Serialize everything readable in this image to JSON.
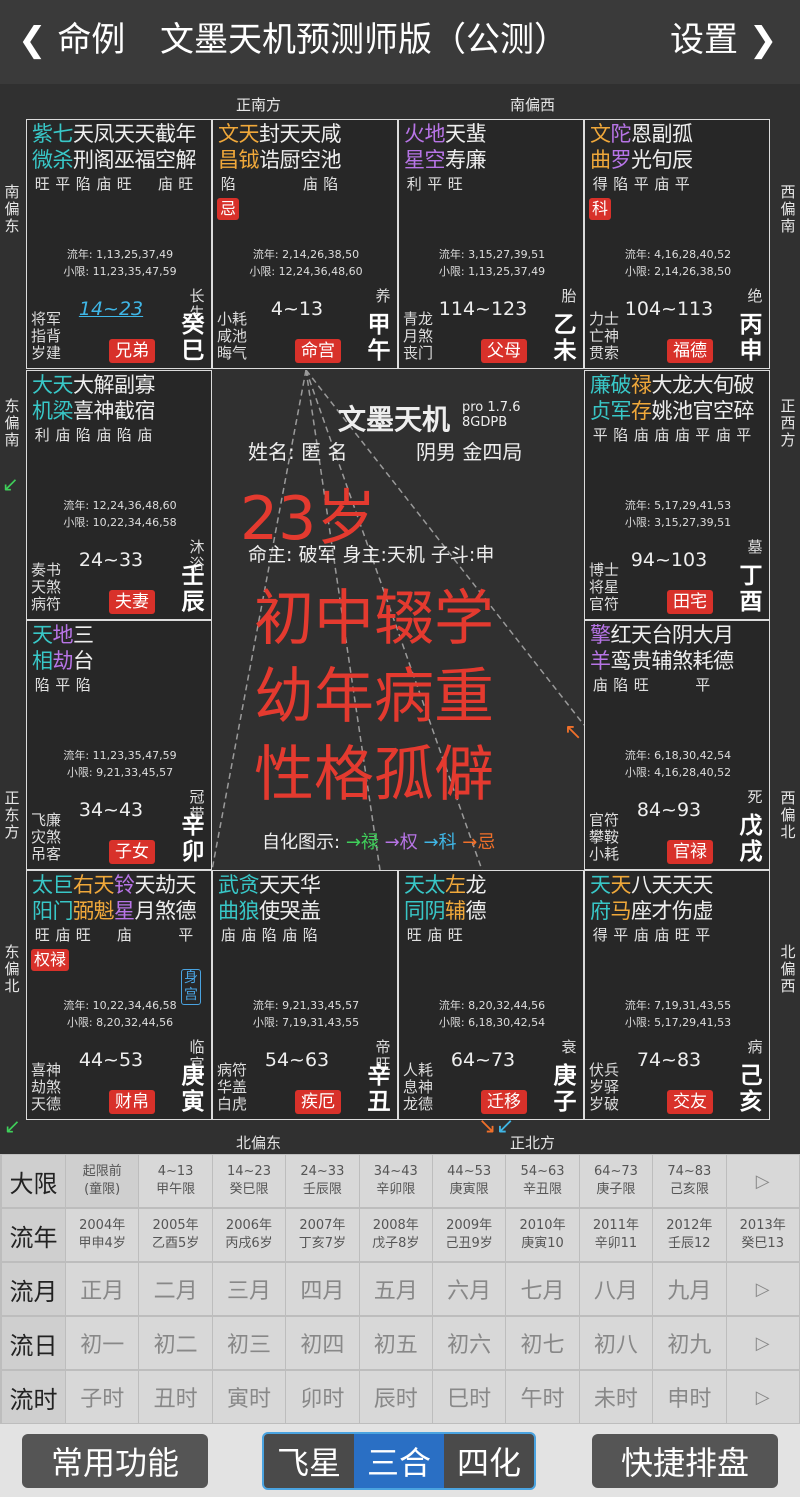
{
  "header": {
    "back_label": "命例",
    "title": "文墨天机预测师版（公测）",
    "settings_label": "设置"
  },
  "directions": {
    "top1": "正南方",
    "top2": "南偏西",
    "left1": "南偏东",
    "left2": "东偏南",
    "left3": "正东方",
    "left4": "东偏北",
    "right1": "西偏南",
    "right2": "正西方",
    "right3": "西偏北",
    "right4": "北偏西",
    "bottom1": "北偏东",
    "bottom2": "正北方"
  },
  "palaces": [
    {
      "stars": [
        [
          "紫微",
          "旺"
        ],
        [
          "七杀",
          "平"
        ],
        [
          "天刑",
          "陷"
        ],
        [
          "凤阁",
          "庙"
        ],
        [
          "天巫",
          "旺"
        ],
        [
          "天福",
          ""
        ],
        [
          "截空",
          "庙"
        ],
        [
          "年解",
          "旺"
        ]
      ],
      "sihua": "",
      "flow1": "流年: 1,13,25,37,49",
      "flow2": "小限: 11,23,35,47,59",
      "range": "14~23",
      "gods": [
        "将军",
        "指背",
        "岁建"
      ],
      "pos": "长生",
      "name": "兄弟",
      "gz": "癸巳"
    },
    {
      "stars": [
        [
          "文昌",
          "陷"
        ],
        [
          "天钺",
          ""
        ],
        [
          "封诰",
          ""
        ],
        [
          "天厨",
          ""
        ],
        [
          "天空",
          "庙"
        ],
        [
          "咸池",
          "陷"
        ]
      ],
      "sihua": "忌",
      "flow1": "流年: 2,14,26,38,50",
      "flow2": "小限: 12,24,36,48,60",
      "range": "4~13",
      "gods": [
        "小耗",
        "咸池",
        "晦气"
      ],
      "pos": "养",
      "name": "命宫",
      "gz": "甲午"
    },
    {
      "stars": [
        [
          "火星",
          "利"
        ],
        [
          "地空",
          "平"
        ],
        [
          "天寿",
          "旺"
        ],
        [
          "蜚廉",
          ""
        ]
      ],
      "sihua": "",
      "flow1": "流年: 3,15,27,39,51",
      "flow2": "小限: 1,13,25,37,49",
      "range": "114~123",
      "gods": [
        "青龙",
        "月煞",
        "丧门"
      ],
      "pos": "胎",
      "name": "父母",
      "gz": "乙未"
    },
    {
      "stars": [
        [
          "文曲",
          "得"
        ],
        [
          "陀罗",
          "陷"
        ],
        [
          "恩光",
          "平"
        ],
        [
          "副旬",
          "庙"
        ],
        [
          "孤辰",
          "平"
        ]
      ],
      "sihua": "科",
      "flow1": "流年: 4,16,28,40,52",
      "flow2": "小限: 2,14,26,38,50",
      "range": "104~113",
      "gods": [
        "力士",
        "亡神",
        "贯索"
      ],
      "pos": "绝",
      "name": "福德",
      "gz": "丙申"
    },
    {
      "stars": [
        [
          "大机",
          "利"
        ],
        [
          "天梁",
          "庙"
        ],
        [
          "大喜",
          "陷"
        ],
        [
          "解神",
          "庙"
        ],
        [
          "副截",
          "陷"
        ],
        [
          "寡宿",
          "庙"
        ]
      ],
      "sihua": "",
      "flow1": "流年: 12,24,36,48,60",
      "flow2": "小限: 10,22,34,46,58",
      "range": "24~33",
      "gods": [
        "奏书",
        "天煞",
        "病符"
      ],
      "pos": "沐浴",
      "name": "夫妻",
      "gz": "壬辰"
    },
    {
      "stars": [
        [
          "廉贞",
          "平"
        ],
        [
          "破军",
          "陷"
        ],
        [
          "禄存",
          "庙"
        ],
        [
          "大姚",
          "庙"
        ],
        [
          "龙池",
          "庙"
        ],
        [
          "大官",
          "平"
        ],
        [
          "旬空",
          "庙"
        ],
        [
          "破碎",
          "平"
        ]
      ],
      "sihua": "",
      "flow1": "流年: 5,17,29,41,53",
      "flow2": "小限: 3,15,27,39,51",
      "range": "94~103",
      "gods": [
        "博士",
        "将星",
        "官符"
      ],
      "pos": "墓",
      "name": "田宅",
      "gz": "丁酉"
    },
    {
      "stars": [
        [
          "天相",
          "陷"
        ],
        [
          "地劫",
          "平"
        ],
        [
          "三台",
          "陷"
        ]
      ],
      "sihua": "",
      "flow1": "流年: 11,23,35,47,59",
      "flow2": "小限: 9,21,33,45,57",
      "range": "34~43",
      "gods": [
        "飞廉",
        "灾煞",
        "吊客"
      ],
      "pos": "冠带",
      "name": "子女",
      "gz": "辛卯"
    },
    {
      "stars": [
        [
          "擎羊",
          "庙"
        ],
        [
          "红鸾",
          "陷"
        ],
        [
          "天贵",
          "旺"
        ],
        [
          "台辅",
          ""
        ],
        [
          "阴煞",
          ""
        ],
        [
          "大耗",
          "平"
        ],
        [
          "月德",
          ""
        ]
      ],
      "sihua": "",
      "flow1": "流年: 6,18,30,42,54",
      "flow2": "小限: 4,16,28,40,52",
      "range": "84~93",
      "gods": [
        "官符",
        "攀鞍",
        "小耗"
      ],
      "pos": "死",
      "name": "官禄",
      "gz": "戊戌"
    },
    {
      "stars": [
        [
          "太阳",
          "旺"
        ],
        [
          "巨门",
          "庙"
        ],
        [
          "右弼",
          "旺"
        ],
        [
          "天魁",
          ""
        ],
        [
          "铃星",
          "庙"
        ],
        [
          "天月",
          ""
        ],
        [
          "劫煞",
          ""
        ],
        [
          "天德",
          "平"
        ]
      ],
      "sihua": "权禄",
      "flow1": "流年: 10,22,34,46,58",
      "flow2": "小限: 8,20,32,44,56",
      "range": "44~53",
      "gods": [
        "喜神",
        "劫煞",
        "天德"
      ],
      "pos": "临官",
      "name": "财帛",
      "gz": "庚寅",
      "body": "身宫"
    },
    {
      "stars": [
        [
          "武曲",
          "庙"
        ],
        [
          "贪狼",
          "庙"
        ],
        [
          "天使",
          "陷"
        ],
        [
          "天哭",
          "庙"
        ],
        [
          "华盖",
          "陷"
        ]
      ],
      "sihua": "",
      "flow1": "流年: 9,21,33,45,57",
      "flow2": "小限: 7,19,31,43,55",
      "range": "54~63",
      "gods": [
        "病符",
        "华盖",
        "白虎"
      ],
      "pos": "帝旺",
      "name": "疾厄",
      "gz": "辛丑"
    },
    {
      "stars": [
        [
          "天同",
          "旺"
        ],
        [
          "太阴",
          "庙"
        ],
        [
          "左辅",
          "旺"
        ],
        [
          "龙德",
          ""
        ]
      ],
      "sihua": "",
      "flow1": "流年: 8,20,32,44,56",
      "flow2": "小限: 6,18,30,42,54",
      "range": "64~73",
      "gods": [
        "人耗",
        "息神",
        "龙德"
      ],
      "pos": "衰",
      "name": "迁移",
      "gz": "庚子"
    },
    {
      "stars": [
        [
          "天府",
          "得"
        ],
        [
          "天马",
          "平"
        ],
        [
          "八座",
          "庙"
        ],
        [
          "天才",
          "庙"
        ],
        [
          "天伤",
          "旺"
        ],
        [
          "天虚",
          "平"
        ]
      ],
      "sihua": "",
      "flow1": "流年: 7,19,31,43,55",
      "flow2": "小限: 5,17,29,41,53",
      "range": "74~83",
      "gods": [
        "伏兵",
        "岁驿",
        "岁破"
      ],
      "pos": "病",
      "name": "交友",
      "gz": "己亥"
    }
  ],
  "center": {
    "app": "文墨天机",
    "version": "pro 1.7.6",
    "code": "8GDPB",
    "name_label": "姓名: 匿 名",
    "gender": "阴男 金四局",
    "age": "23岁",
    "master": "命主: 破军 身主:天机 子斗:申",
    "line1": "初中辍学",
    "line2": "幼年病重",
    "line3": "性格孤僻",
    "legend_label": "自化图示:",
    "lg_lu": "→禄",
    "lg_quan": "→权",
    "lg_ke": "→科",
    "lg_ji": "→忌"
  },
  "rows": {
    "dayun": {
      "label": "大限",
      "cells": [
        [
          "起限前",
          "(童限)"
        ],
        [
          "4~13",
          "甲午限"
        ],
        [
          "14~23",
          "癸巳限"
        ],
        [
          "24~33",
          "壬辰限"
        ],
        [
          "34~43",
          "辛卯限"
        ],
        [
          "44~53",
          "庚寅限"
        ],
        [
          "54~63",
          "辛丑限"
        ],
        [
          "64~73",
          "庚子限"
        ],
        [
          "74~83",
          "己亥限"
        ]
      ],
      "next": "▷"
    },
    "liunian": {
      "label": "流年",
      "cells": [
        [
          "2004年",
          "甲申4岁"
        ],
        [
          "2005年",
          "乙酉5岁"
        ],
        [
          "2006年",
          "丙戌6岁"
        ],
        [
          "2007年",
          "丁亥7岁"
        ],
        [
          "2008年",
          "戊子8岁"
        ],
        [
          "2009年",
          "己丑9岁"
        ],
        [
          "2010年",
          "庚寅10"
        ],
        [
          "2011年",
          "辛卯11"
        ],
        [
          "2012年",
          "壬辰12"
        ],
        [
          "2013年",
          "癸巳13"
        ]
      ]
    },
    "liuyue": {
      "label": "流月",
      "cells": [
        "正月",
        "二月",
        "三月",
        "四月",
        "五月",
        "六月",
        "七月",
        "八月",
        "九月"
      ],
      "next": "▷"
    },
    "liuri": {
      "label": "流日",
      "cells": [
        "初一",
        "初二",
        "初三",
        "初四",
        "初五",
        "初六",
        "初七",
        "初八",
        "初九"
      ],
      "next": "▷"
    },
    "liushi": {
      "label": "流时",
      "cells": [
        "子时",
        "丑时",
        "寅时",
        "卯时",
        "辰时",
        "巳时",
        "午时",
        "未时",
        "申时"
      ],
      "next": "▷"
    }
  },
  "bottom": {
    "common": "常用功能",
    "feixing": "飞星",
    "sanhe": "三合",
    "sihua": "四化",
    "quick": "快捷排盘"
  },
  "colors": {
    "accent_red": "#d8312a",
    "main_star": "#38c7c7",
    "blue": "#3fb6e6"
  }
}
